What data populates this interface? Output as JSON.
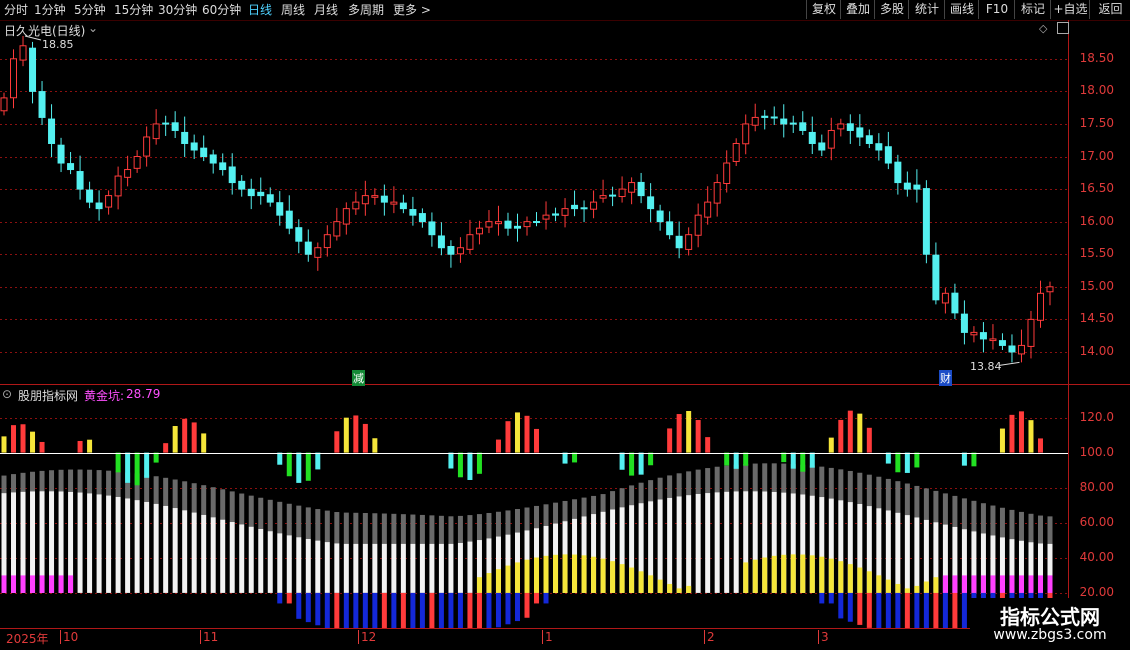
{
  "toolbar": {
    "timeframes": [
      "分时",
      "1分钟",
      "5分钟",
      "15分钟",
      "30分钟",
      "60分钟",
      "日线",
      "周线",
      "月线",
      "多周期",
      "更多 >"
    ],
    "active_timeframe": "日线",
    "buttons": [
      "复权",
      "叠加",
      "多股",
      "统计",
      "画线",
      "F10",
      "标记",
      "+自选",
      "返回"
    ]
  },
  "stock": {
    "title": "日久光电(日线)",
    "high_label": "18.85",
    "low_label": "13.84",
    "marker_1": "减",
    "marker_2": "财"
  },
  "indicator": {
    "name": "股朋指标网",
    "series_label": "黄金坑:",
    "series_value": "28.79"
  },
  "price_axis": [
    "18.50",
    "18.00",
    "17.50",
    "17.00",
    "16.50",
    "16.00",
    "15.50",
    "15.00",
    "14.50",
    "14.00"
  ],
  "indicator_axis": [
    "120.0",
    "100.0",
    "80.00",
    "60.00",
    "40.00",
    "20.00"
  ],
  "date_axis": [
    "2025年",
    "10",
    "11",
    "12",
    "1",
    "2",
    "3"
  ],
  "watermark": {
    "title": "指标公式网",
    "url": "www.zbgs3.com"
  },
  "colors": {
    "up": "#ff3b3b",
    "down": "#54f0f0",
    "grid": "#8b1010",
    "active_tab": "#4fd2ff",
    "yellow": "#f5e63a",
    "magenta": "#ff40ff",
    "blue": "#1428d8",
    "green": "#22e022",
    "gray": "#6a6a6a",
    "white": "#f2f2f2"
  },
  "chart_data": [
    {
      "type": "candlestick",
      "title": "日久光电(日线)",
      "ylim": [
        13.6,
        18.85
      ],
      "yticks": [
        18.5,
        18.0,
        17.5,
        17.0,
        16.5,
        16.0,
        15.5,
        15.0,
        14.5,
        14.0
      ],
      "annotations": [
        {
          "text": "18.85",
          "at": "period high"
        },
        {
          "text": "13.84",
          "at": "period low"
        }
      ],
      "x_labels": [
        "2025年",
        "10",
        "11",
        "12",
        "1",
        "2",
        "3"
      ],
      "closes": [
        17.9,
        18.5,
        18.7,
        18.0,
        17.6,
        17.2,
        16.9,
        16.8,
        16.5,
        16.3,
        16.2,
        16.4,
        16.7,
        16.8,
        17.0,
        17.3,
        17.5,
        17.5,
        17.4,
        17.2,
        17.1,
        17.0,
        16.9,
        16.8,
        16.6,
        16.5,
        16.4,
        16.4,
        16.3,
        16.1,
        15.9,
        15.7,
        15.5,
        15.6,
        15.8,
        16.0,
        16.2,
        16.3,
        16.4,
        16.4,
        16.3,
        16.3,
        16.2,
        16.1,
        16.0,
        15.8,
        15.6,
        15.5,
        15.6,
        15.8,
        15.9,
        16.0,
        16.0,
        15.9,
        15.9,
        16.0,
        16.0,
        16.1,
        16.1,
        16.2,
        16.2,
        16.2,
        16.3,
        16.4,
        16.4,
        16.5,
        16.6,
        16.4,
        16.2,
        16.0,
        15.8,
        15.6,
        15.8,
        16.1,
        16.3,
        16.6,
        16.9,
        17.2,
        17.5,
        17.6,
        17.6,
        17.6,
        17.5,
        17.5,
        17.4,
        17.2,
        17.1,
        17.4,
        17.5,
        17.4,
        17.3,
        17.2,
        17.1,
        16.9,
        16.6,
        16.5,
        16.5,
        15.5,
        14.8,
        14.9,
        14.6,
        14.3,
        14.3,
        14.2,
        14.2,
        14.1,
        14.0,
        14.1,
        14.5,
        14.9,
        15.0
      ],
      "extremes": [
        {
          "index": 2,
          "high": 18.85
        },
        {
          "index": 107,
          "low": 13.84
        }
      ]
    },
    {
      "type": "bar",
      "title": "股朋指标网",
      "series": [
        {
          "name": "黄金坑",
          "last_value": 28.79
        }
      ],
      "ylim": [
        0,
        130
      ],
      "yticks": [
        120,
        100,
        80,
        60,
        40,
        20
      ]
    }
  ]
}
